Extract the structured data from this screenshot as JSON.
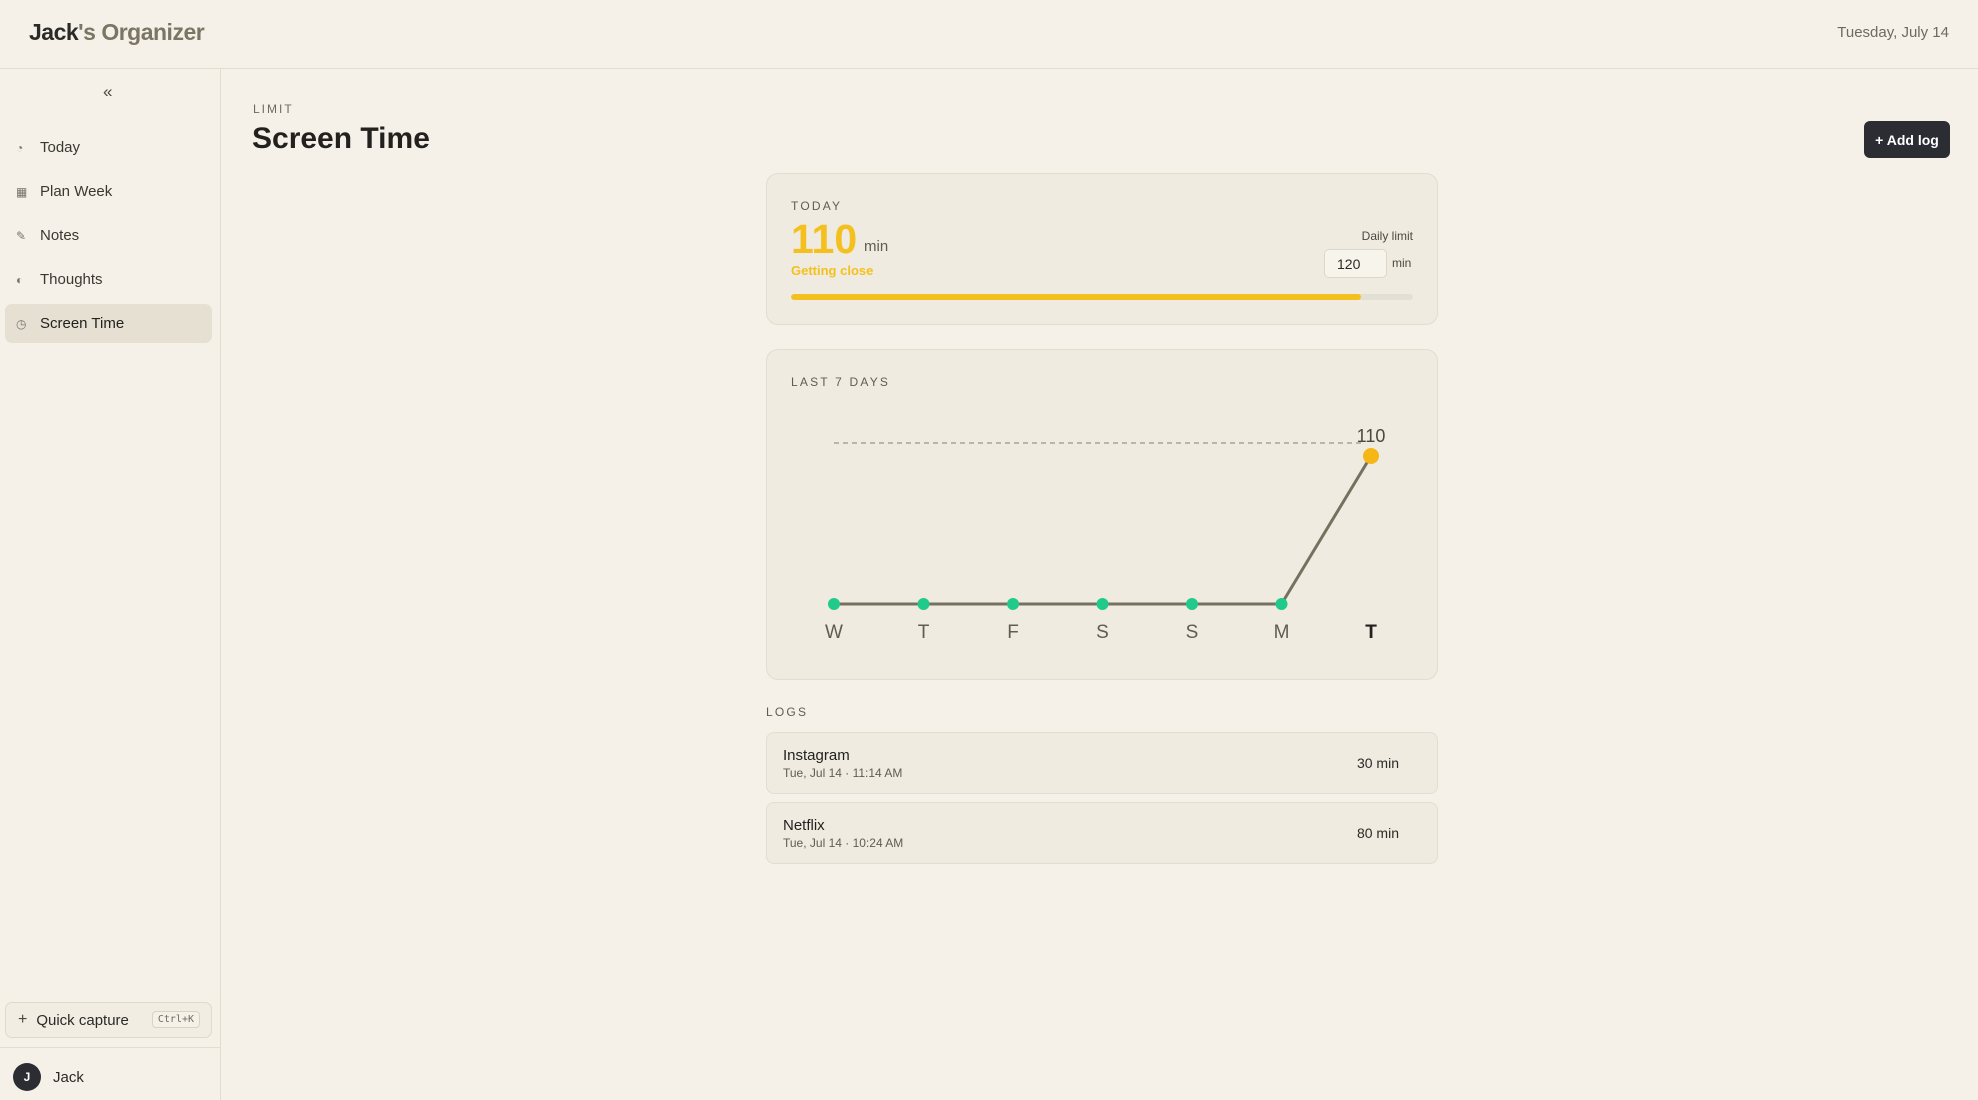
{
  "app": {
    "brand_first": "Jack",
    "brand_rest": "'s Organizer",
    "date": "Tuesday, July 14"
  },
  "sidebar": {
    "collapse_label": "«",
    "items": [
      {
        "label": "Today",
        "icon": "clock-icon",
        "glyph": "◔",
        "active": false
      },
      {
        "label": "Plan Week",
        "icon": "grid-icon",
        "glyph": "▦",
        "active": false
      },
      {
        "label": "Notes",
        "icon": "pencil-icon",
        "glyph": "✎",
        "active": false
      },
      {
        "label": "Thoughts",
        "icon": "half-circle-icon",
        "glyph": "◐",
        "active": false
      },
      {
        "label": "Screen Time",
        "icon": "timer-icon",
        "glyph": "◷",
        "active": true
      }
    ],
    "quick_capture": {
      "label": "Quick capture",
      "shortcut": "Ctrl+K"
    },
    "user": {
      "initial": "J",
      "name": "Jack"
    }
  },
  "header": {
    "eyebrow": "LIMIT",
    "title": "Screen Time",
    "add_button": "+ Add log"
  },
  "today": {
    "label": "TODAY",
    "minutes": "110",
    "unit": "min",
    "status": "Getting close",
    "limit_label": "Daily limit",
    "limit_value": "120",
    "limit_unit": "min",
    "progress_fraction": 0.9167,
    "accent": "#f4c01f"
  },
  "chart_data": {
    "type": "line",
    "title": "LAST 7 DAYS",
    "categories": [
      "W",
      "T",
      "F",
      "S",
      "S",
      "M",
      "T"
    ],
    "values": [
      0,
      0,
      0,
      0,
      0,
      0,
      110
    ],
    "highlight_index": 6,
    "highlight_label": "110",
    "limit_line": 110,
    "ylim": [
      0,
      140
    ],
    "colors": {
      "line": "#76705f",
      "point": "#1fca8a",
      "highlight": "#f5b716",
      "limit": "#a8a398"
    }
  },
  "logs": {
    "label": "LOGS",
    "items": [
      {
        "name": "Instagram",
        "time": "Tue, Jul 14 · 11:14 AM",
        "minutes": "30 min"
      },
      {
        "name": "Netflix",
        "time": "Tue, Jul 14 · 10:24 AM",
        "minutes": "80 min"
      }
    ]
  }
}
